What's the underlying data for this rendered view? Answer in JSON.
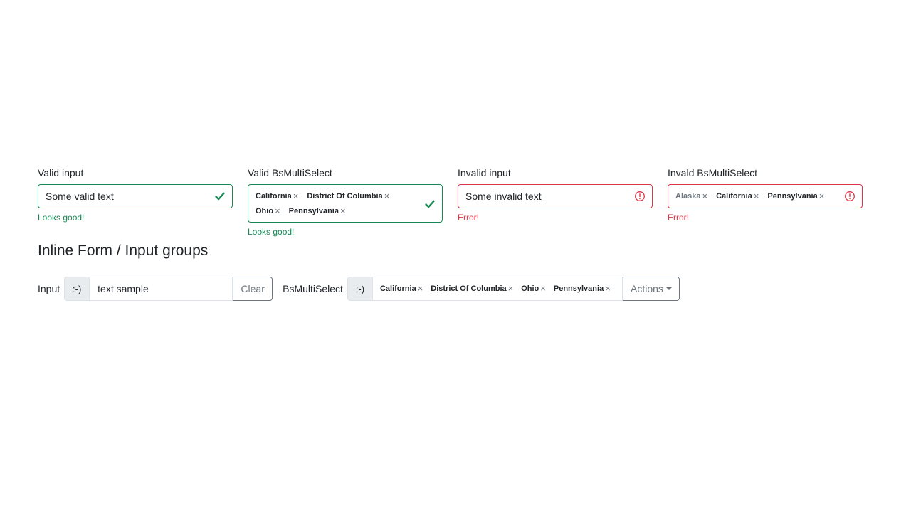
{
  "form": {
    "valid_input": {
      "label": "Valid input",
      "value": "Some valid text",
      "feedback": "Looks good!",
      "status_icon": "check-icon",
      "status_color": "#198754"
    },
    "valid_multiselect": {
      "label": "Valid BsMultiSelect",
      "chips": [
        "California",
        "District Of Columbia",
        "Ohio",
        "Pennsylvania"
      ],
      "remove_glyph": "×",
      "feedback": "Looks good!",
      "status_icon": "check-icon",
      "status_color": "#198754"
    },
    "invalid_input": {
      "label": "Invalid input",
      "value": "Some invalid text",
      "feedback": "Error!",
      "status_icon": "exclamation-circle-icon",
      "status_color": "#dc3545"
    },
    "invalid_multiselect": {
      "label": "Invald BsMultiSelect",
      "chips": [
        "Alaska",
        "California",
        "Pennsylvania"
      ],
      "remove_glyph": "×",
      "feedback": "Error!",
      "status_icon": "exclamation-circle-icon",
      "status_color": "#dc3545"
    }
  },
  "inline_section": {
    "title": "Inline Form / Input groups",
    "input_group": {
      "label": "Input",
      "addon": ":-)",
      "value": "text sample",
      "button": "Clear"
    },
    "multiselect_group": {
      "label": "BsMultiSelect",
      "addon": ":-)",
      "chips": [
        "California",
        "District Of Columbia",
        "Ohio",
        "Pennsylvania"
      ],
      "remove_glyph": "×",
      "button": "Actions",
      "button_icon": "caret-down-icon"
    }
  }
}
